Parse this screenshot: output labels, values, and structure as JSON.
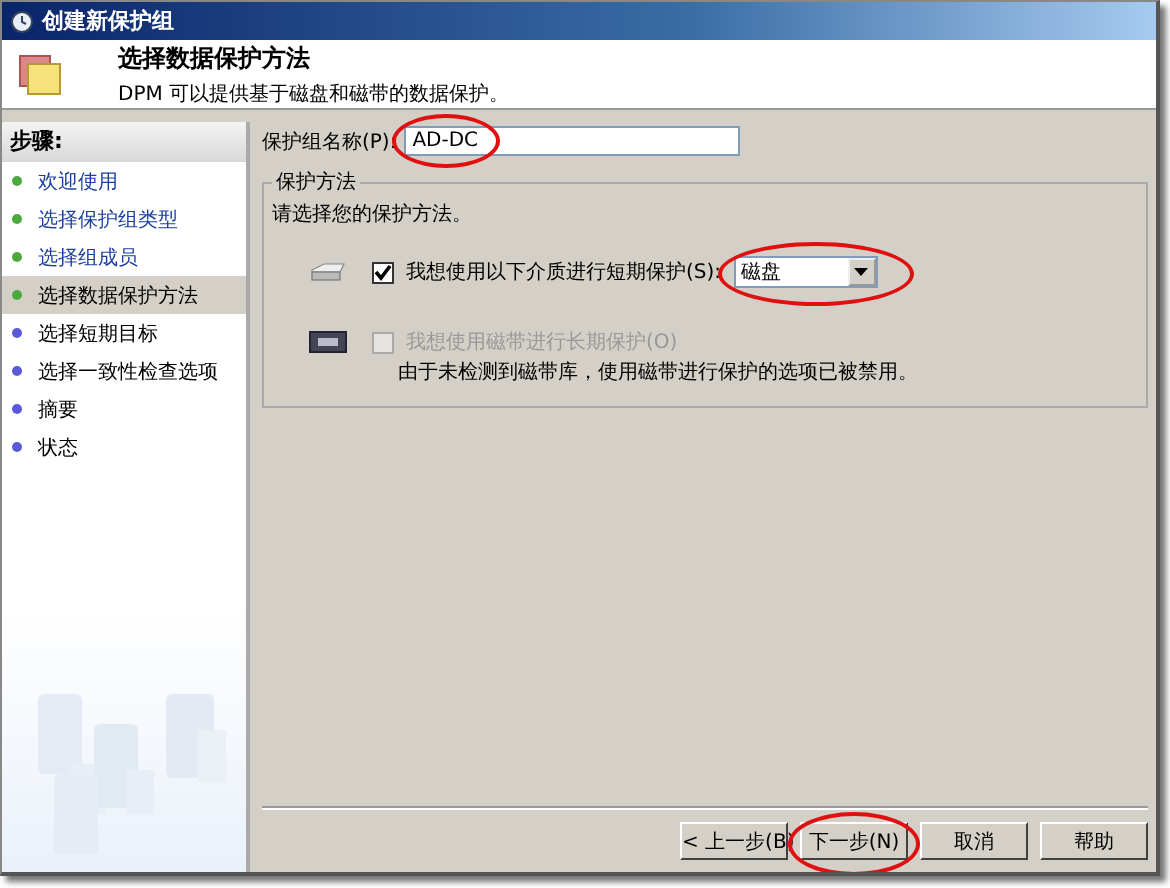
{
  "window": {
    "title": "创建新保护组"
  },
  "header": {
    "title": "选择数据保护方法",
    "subtitle": "DPM 可以提供基于磁盘和磁带的数据保护。"
  },
  "steps_heading": "步骤:",
  "steps": [
    {
      "label": "欢迎使用",
      "completed": true,
      "selected": false
    },
    {
      "label": "选择保护组类型",
      "completed": true,
      "selected": false
    },
    {
      "label": "选择组成员",
      "completed": true,
      "selected": false
    },
    {
      "label": "选择数据保护方法",
      "completed": true,
      "selected": true
    },
    {
      "label": "选择短期目标",
      "completed": false,
      "selected": false
    },
    {
      "label": "选择一致性检查选项",
      "completed": false,
      "selected": false
    },
    {
      "label": "摘要",
      "completed": false,
      "selected": false
    },
    {
      "label": "状态",
      "completed": false,
      "selected": false
    }
  ],
  "name_field": {
    "label": "保护组名称(P):",
    "value": "AD-DC",
    "circled": true
  },
  "method_group": {
    "title": "保护方法",
    "prompt": "请选择您的保护方法。",
    "short_term": {
      "label": "我想使用以下介质进行短期保护(S):",
      "checked": true,
      "disabled": false,
      "medium": "磁盘",
      "circled": true
    },
    "long_term": {
      "label": "我想使用磁带进行长期保护(O)",
      "checked": false,
      "disabled": true,
      "note": "由于未检测到磁带库，使用磁带进行保护的选项已被禁用。"
    }
  },
  "buttons": [
    {
      "label": "< 上一步(B)",
      "circled": false
    },
    {
      "label": "下一步(N)",
      "circled": true
    },
    {
      "label": "取消",
      "circled": false
    },
    {
      "label": "帮助",
      "circled": false
    }
  ]
}
